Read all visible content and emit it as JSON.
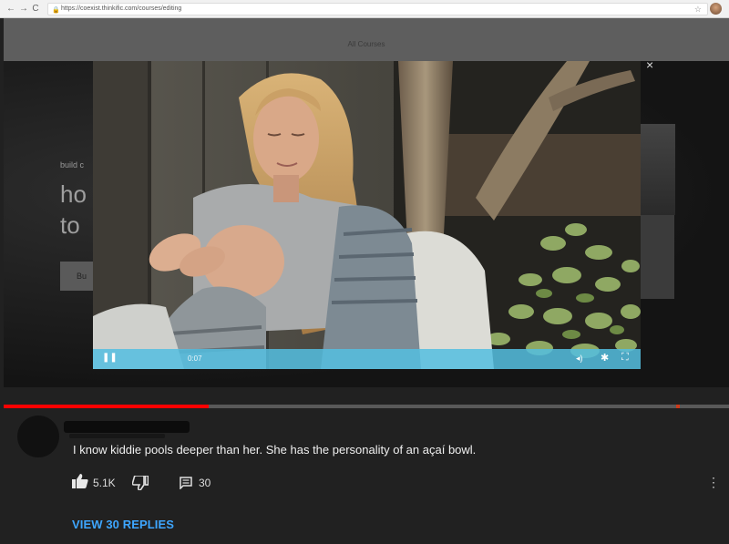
{
  "browser": {
    "back": "←",
    "forward": "→",
    "reload": "C",
    "url": "https://coexist.thinkific.com/courses/editing",
    "lock": "🔒",
    "star": "☆"
  },
  "site": {
    "nav_label": "All Courses",
    "hero_small": "build c",
    "hero_line1": "ho",
    "hero_line2": "to",
    "hero_button": "Bu",
    "close": "×"
  },
  "player": {
    "time": "0:07",
    "pause": "❚❚",
    "volume": "◂)",
    "settings": "✱",
    "fullscreen": "⛶"
  },
  "comment": {
    "text": "I know kiddie pools deeper than her. She has the personality of an açaí bowl.",
    "likes": "5.1K",
    "replies_count": "30",
    "view_replies": "VIEW 30 REPLIES",
    "more": "⋮"
  },
  "colors": {
    "accent_blue": "#3ea6ff",
    "progress_red": "#ff0000",
    "player_bar": "#54bee1"
  },
  "icons": [
    "back-icon",
    "forward-icon",
    "reload-icon",
    "lock-icon",
    "star-icon",
    "close-icon",
    "pause-icon",
    "volume-icon",
    "settings-icon",
    "fullscreen-icon",
    "thumbs-up-icon",
    "thumbs-down-icon",
    "reply-icon",
    "more-options-icon"
  ]
}
